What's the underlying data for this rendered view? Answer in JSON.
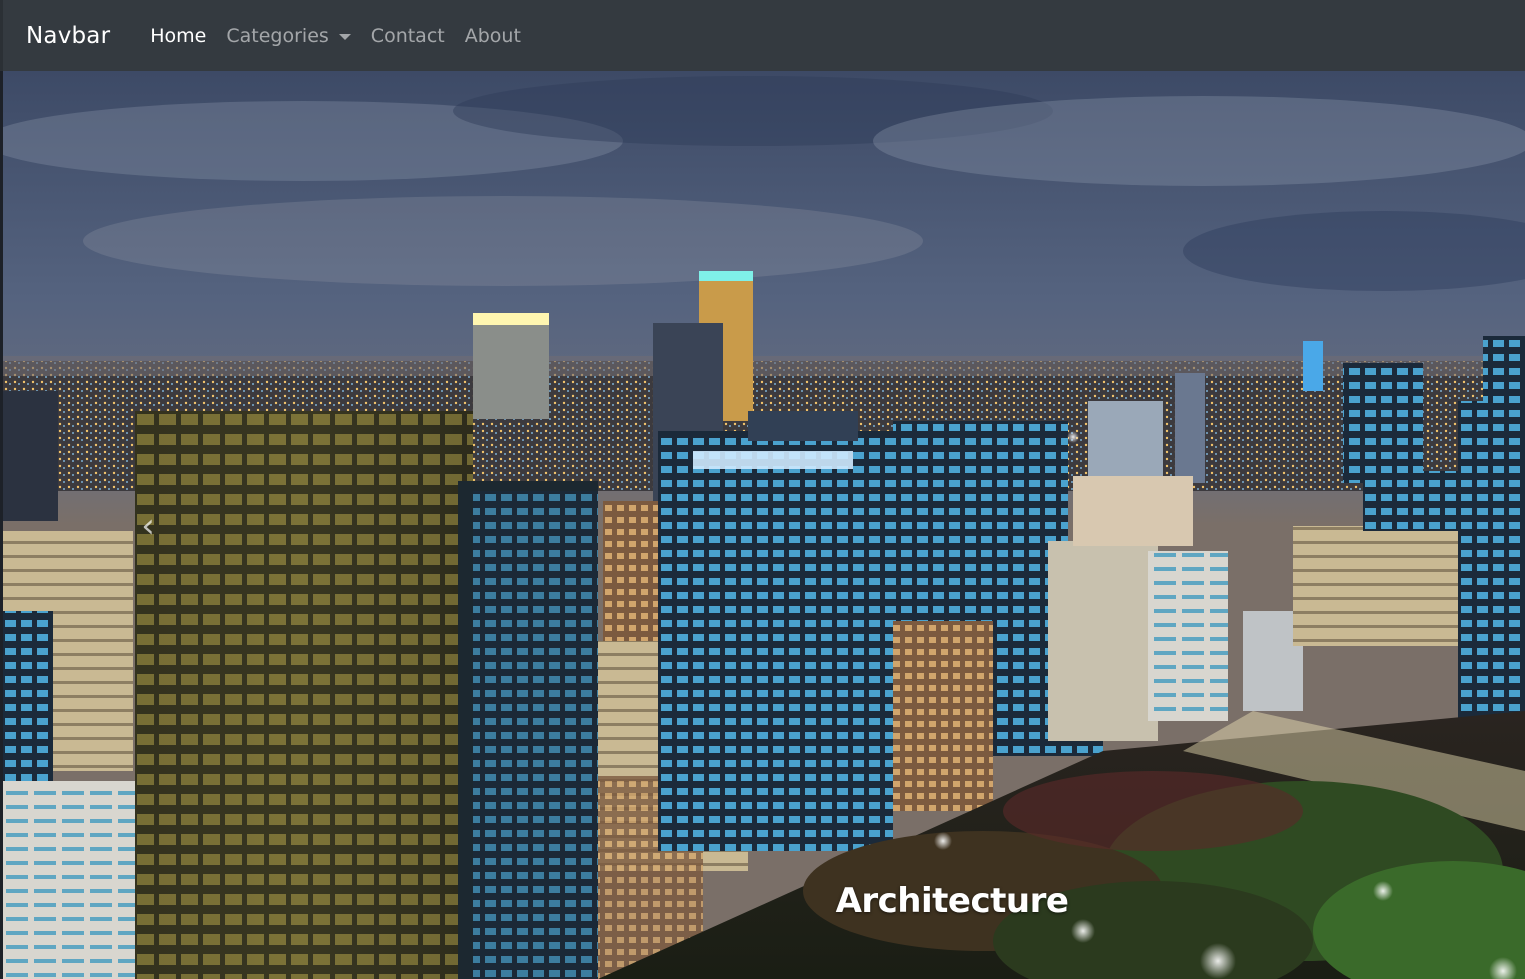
{
  "navbar": {
    "brand": "Navbar",
    "links": [
      {
        "label": "Home",
        "active": true
      },
      {
        "label": "Categories",
        "dropdown": true
      },
      {
        "label": "Contact"
      },
      {
        "label": "About"
      }
    ]
  },
  "carousel": {
    "image": "night-city-skyline",
    "caption": "Architecture",
    "prev_icon": "chevron-left-icon"
  },
  "colors": {
    "navbar_bg": "#343a40",
    "nav_active": "#ffffff",
    "nav_inactive": "rgba(255,255,255,0.55)"
  }
}
